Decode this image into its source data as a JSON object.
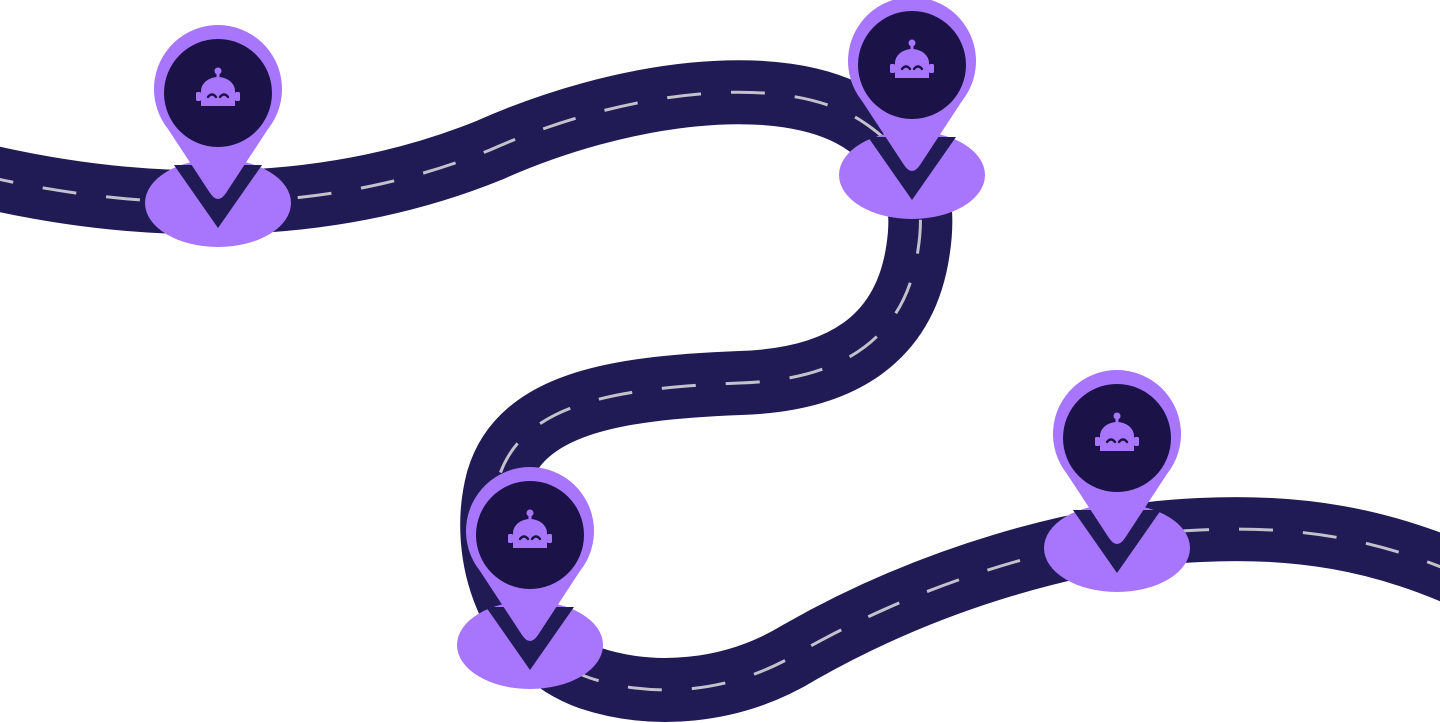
{
  "colors": {
    "background": "#ffffff",
    "road": "#201a55",
    "road_dash": "#c2c2cc",
    "pin_fill": "#a876fc",
    "pin_inner": "#1b1348",
    "robot": "#a876fc"
  },
  "road": {
    "icon": "winding-road"
  },
  "waypoints": [
    {
      "name": "waypoint-1",
      "icon": "robot-icon"
    },
    {
      "name": "waypoint-2",
      "icon": "robot-icon"
    },
    {
      "name": "waypoint-3",
      "icon": "robot-icon"
    },
    {
      "name": "waypoint-4",
      "icon": "robot-icon"
    }
  ]
}
